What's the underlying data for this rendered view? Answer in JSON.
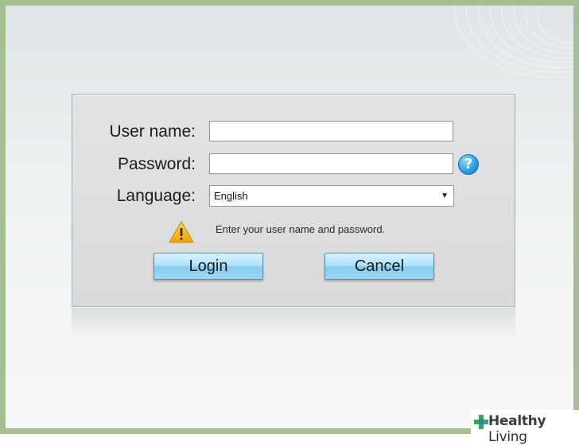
{
  "form": {
    "username_label": "User name:",
    "username_value": "",
    "password_label": "Password:",
    "password_value": "",
    "language_label": "Language:",
    "language_selected": "English",
    "message": "Enter your user name and password.",
    "login_label": "Login",
    "cancel_label": "Cancel",
    "help_symbol": "?",
    "warning_symbol": "!"
  },
  "watermark": {
    "text_bold": "Healthy",
    "text_regular": " Living"
  },
  "colors": {
    "border_frame": "#a6bf91",
    "button_accent": "#86cdf0",
    "help_icon": "#2fa0e6",
    "warning_icon": "#f5b400"
  },
  "icons": [
    "question-help-icon",
    "warning-triangle-icon",
    "dropdown-arrow-icon",
    "healthy-living-cross-icon"
  ]
}
